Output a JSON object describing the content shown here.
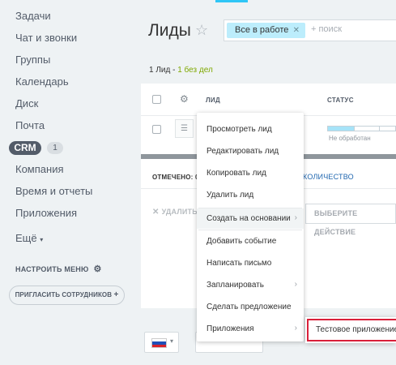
{
  "sidebar": {
    "items": [
      "Задачи",
      "Чат и звонки",
      "Группы",
      "Календарь",
      "Диск",
      "Почта"
    ],
    "crm_label": "CRM",
    "crm_count": "1",
    "items_after": [
      "Компания",
      "Время и отчеты",
      "Приложения"
    ],
    "more_label": "Ещё",
    "settings_label": "НАСТРОИТЬ МЕНЮ",
    "invite_label": "ПРИГЛАСИТЬ СОТРУДНИКОВ"
  },
  "header": {
    "title": "Лиды",
    "filter_tag": "Все в работе",
    "search_placeholder": "+ поиск"
  },
  "summary": {
    "leads": "1 Лид -",
    "no_deals": "1 без дел"
  },
  "grid": {
    "col_lead": "ЛИД",
    "col_status": "СТАТУС",
    "status_text": "Не обработан",
    "status_progress": 0.38,
    "marked_label": "ОТМЕЧЕНО: 0",
    "count_link": "КОЛИЧЕСТВО",
    "delete_label": "УДАЛИТЬ",
    "action_placeholder": "ВЫБЕРИТЕ ДЕЙСТВИЕ"
  },
  "context_menu": {
    "items": [
      {
        "label": "Просмотреть лид",
        "submenu": false
      },
      {
        "label": "Редактировать лид",
        "submenu": false
      },
      {
        "label": "Копировать лид",
        "submenu": false
      },
      {
        "label": "Удалить лид",
        "submenu": false
      },
      {
        "label": "Создать на основании",
        "submenu": true
      },
      {
        "label": "Добавить событие",
        "submenu": false
      },
      {
        "label": "Написать письмо",
        "submenu": false
      },
      {
        "label": "Запланировать",
        "submenu": true
      },
      {
        "label": "Сделать предложение",
        "submenu": false
      },
      {
        "label": "Приложения",
        "submenu": true
      }
    ],
    "submenu_item": "Тестовое приложение"
  },
  "colors": {
    "accent": "#2fc6f6",
    "filter_tag_bg": "#bcedfc",
    "highlight_border": "#d9203a",
    "green": "#7fa800",
    "link": "#2067b0"
  }
}
